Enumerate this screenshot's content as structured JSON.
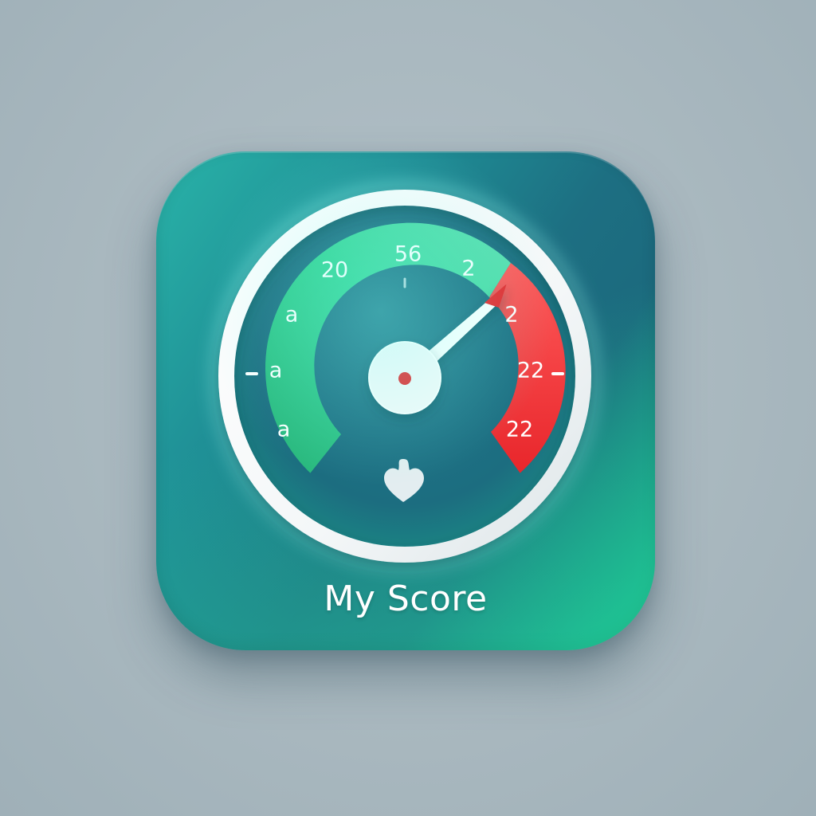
{
  "app": {
    "label": "My Score",
    "icon_name": "speedometer-gauge-icon",
    "background_color": "#a9b8bf",
    "tile_gradient": [
      "#29b3a8",
      "#1d6f82",
      "#17b889"
    ]
  },
  "gauge": {
    "scale_labels": [
      "a",
      "a",
      "a",
      "20",
      "56",
      "2",
      "2",
      "22",
      "22"
    ],
    "zone_colors": {
      "green": "#2fc98a",
      "red": "#f0373b",
      "ring": "#ffffff",
      "needle_tip": "#e8262b"
    },
    "emblem_icon": "heart-icon"
  }
}
